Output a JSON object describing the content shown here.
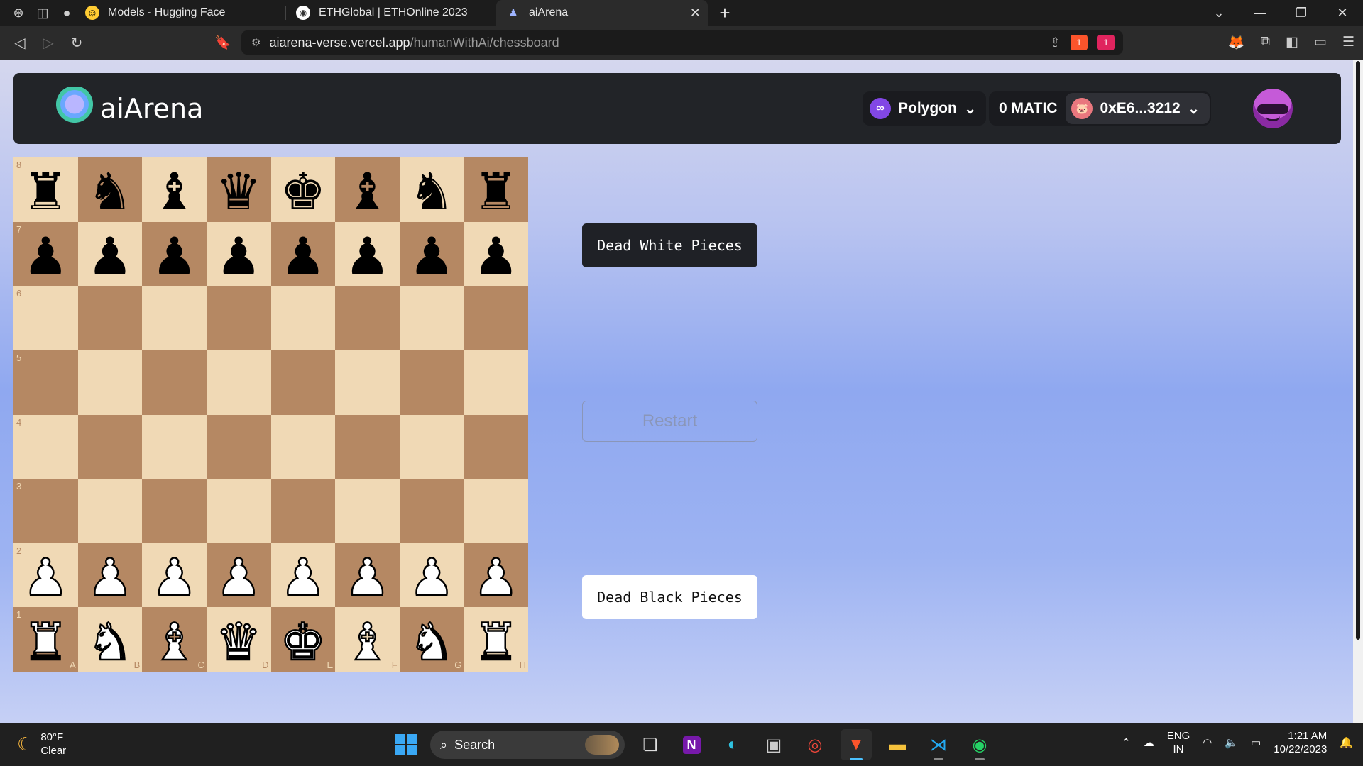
{
  "browser": {
    "tabs": [
      {
        "title": "Models - Hugging Face",
        "icon": "hugging-face-icon",
        "active": false
      },
      {
        "title": "ETHGlobal | ETHOnline 2023",
        "icon": "ethglobal-icon",
        "active": false
      },
      {
        "title": "aiArena",
        "icon": "aiarena-icon",
        "active": true
      }
    ],
    "url_domain": "aiarena-verse.vercel.app",
    "url_path": "/humanWithAi/chessboard",
    "shield_count": "1",
    "alert_count": "1"
  },
  "header": {
    "logo_text": "aiArena",
    "chain_name": "Polygon",
    "balance": "0 MATIC",
    "address": "0xE6...3212"
  },
  "board": {
    "ranks": [
      "8",
      "7",
      "6",
      "5",
      "4",
      "3",
      "2",
      "1"
    ],
    "files": [
      "A",
      "B",
      "C",
      "D",
      "E",
      "F",
      "G",
      "H"
    ],
    "rows": [
      [
        "r",
        "n",
        "b",
        "q",
        "k",
        "b",
        "n",
        "r"
      ],
      [
        "p",
        "p",
        "p",
        "p",
        "p",
        "p",
        "p",
        "p"
      ],
      [
        "",
        "",
        "",
        "",
        "",
        "",
        "",
        ""
      ],
      [
        "",
        "",
        "",
        "",
        "",
        "",
        "",
        ""
      ],
      [
        "",
        "",
        "",
        "",
        "",
        "",
        "",
        ""
      ],
      [
        "",
        "",
        "",
        "",
        "",
        "",
        "",
        ""
      ],
      [
        "P",
        "P",
        "P",
        "P",
        "P",
        "P",
        "P",
        "P"
      ],
      [
        "R",
        "N",
        "B",
        "Q",
        "K",
        "B",
        "N",
        "R"
      ]
    ],
    "light_color": "#f0d9b5",
    "dark_color": "#b58863"
  },
  "panel": {
    "dead_white_label": "Dead White Pieces",
    "restart_label": "Restart",
    "dead_black_label": "Dead Black Pieces"
  },
  "taskbar": {
    "temperature": "80°F",
    "condition": "Clear",
    "search_label": "Search",
    "lang_top": "ENG",
    "lang_bottom": "IN",
    "time": "1:21 AM",
    "date": "10/22/2023"
  }
}
